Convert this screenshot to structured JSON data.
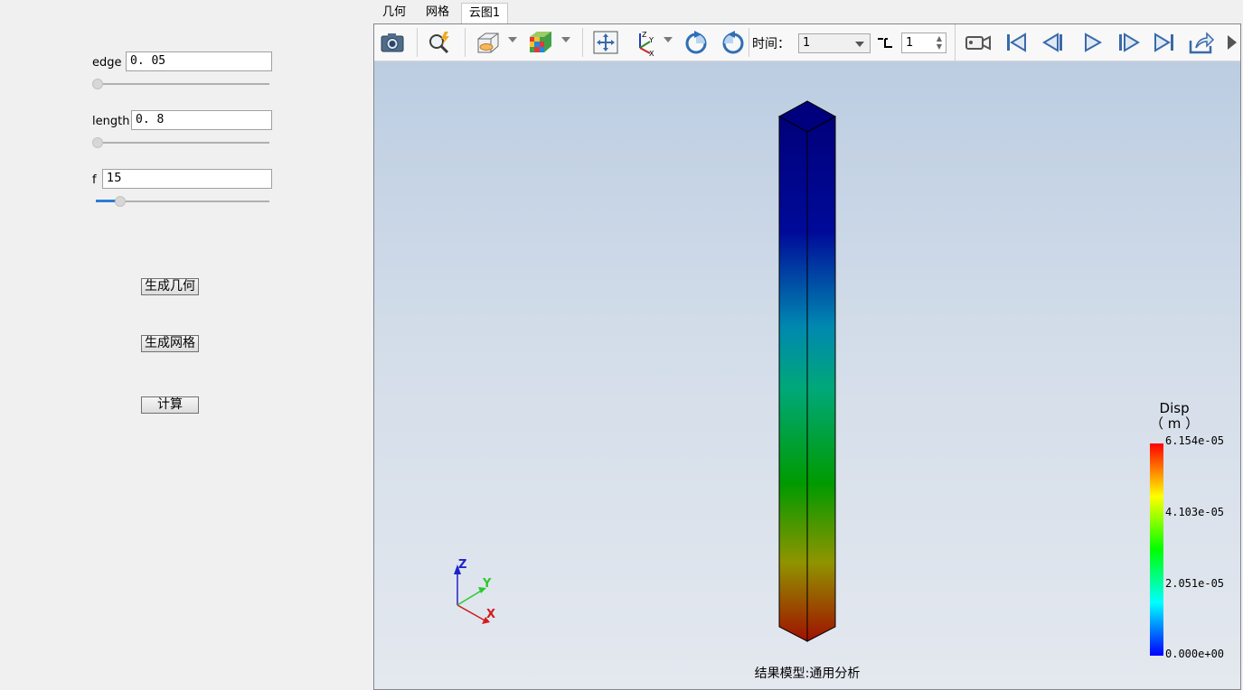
{
  "left_panel": {
    "params": [
      {
        "label": "edge",
        "value": "0. 05",
        "slider_fraction": 0.0
      },
      {
        "label": "length",
        "value": "0. 8",
        "slider_fraction": 0.0
      },
      {
        "label": "f",
        "value": "15",
        "slider_fraction": 0.13
      }
    ],
    "buttons": {
      "geometry": "生成几何",
      "mesh": "生成网格",
      "compute": "计算"
    }
  },
  "tabs": [
    {
      "label": "几何",
      "active": false
    },
    {
      "label": "网格",
      "active": false
    },
    {
      "label": "云图1",
      "active": true
    }
  ],
  "toolbar": {
    "icons": [
      "camera-icon",
      "zoom-fit-icon",
      "display-mode-icon",
      "color-cube-icon",
      "pan-icon",
      "axes-triad-icon",
      "rotate-cw-icon",
      "rotate-ccw-icon",
      "record-video-icon",
      "first-frame-icon",
      "previous-frame-icon",
      "play-icon",
      "next-frame-icon",
      "last-frame-icon",
      "export-icon"
    ],
    "time_label": "时间：",
    "time_value": "1",
    "step_value": "1"
  },
  "viewport": {
    "legend": {
      "title": "Disp",
      "unit": "（ m ）",
      "ticks": [
        "6.154e-05",
        "4.103e-05",
        "2.051e-05",
        "0.000e+00"
      ],
      "colors": [
        "#ff0000",
        "#ffff00",
        "#00ff00",
        "#00ffff",
        "#0000ff"
      ]
    },
    "triad": {
      "x": "X",
      "y": "Y",
      "z": "Z"
    },
    "caption": "结果模型:通用分析"
  }
}
